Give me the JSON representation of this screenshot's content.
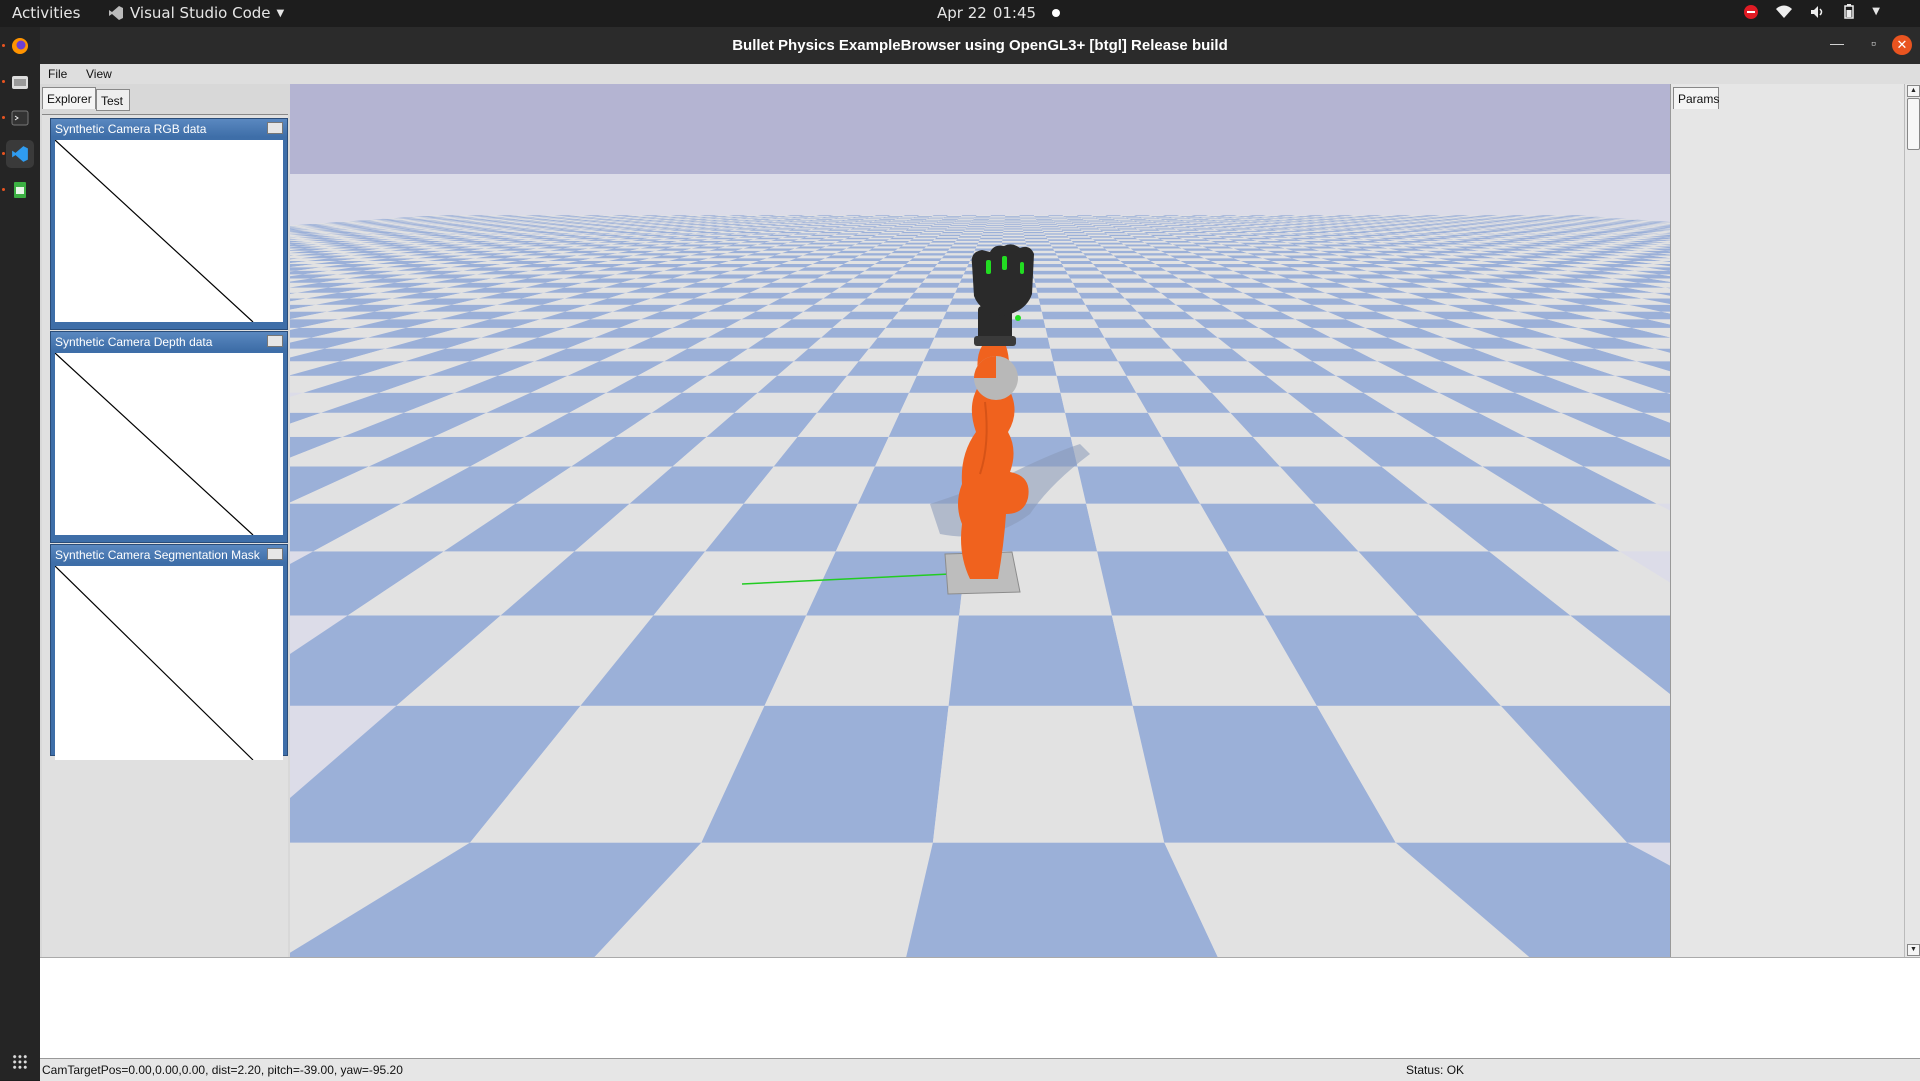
{
  "topbar": {
    "activities": "Activities",
    "app_name": "Visual Studio Code",
    "date": "Apr 22",
    "time": "01:45",
    "icons": [
      "do-not-disturb-icon",
      "wifi-icon",
      "volume-icon",
      "battery-icon",
      "power-icon"
    ]
  },
  "dock": {
    "items": [
      "firefox-icon",
      "files-icon",
      "terminal-icon",
      "vscode-icon",
      "spreadsheet-icon"
    ]
  },
  "window": {
    "title": "Bullet Physics ExampleBrowser using OpenGL3+ [btgl] Release build",
    "controls": [
      "minimize-icon",
      "maximize-icon",
      "close-icon"
    ]
  },
  "menubar": {
    "file": "File",
    "view": "View"
  },
  "left_panel": {
    "tabs": [
      {
        "label": "Explorer",
        "active": true
      },
      {
        "label": "Test",
        "active": false
      }
    ],
    "camera_windows": [
      "Synthetic Camera RGB data",
      "Synthetic Camera Depth data",
      "Synthetic Camera Segmentation Mask"
    ]
  },
  "right_panel": {
    "tab": "Params"
  },
  "status": {
    "camera": "CamTargetPos=0.00,0.00,0.00, dist=2.20, pitch=-39.00, yaw=-95.20",
    "status": "Status: OK"
  },
  "colors": {
    "floor_blue": "#9bb0d8",
    "floor_light": "#e2e2e2",
    "sky": "#b4b4d2",
    "robot_orange": "#f0621e",
    "accent": "#e95420"
  }
}
